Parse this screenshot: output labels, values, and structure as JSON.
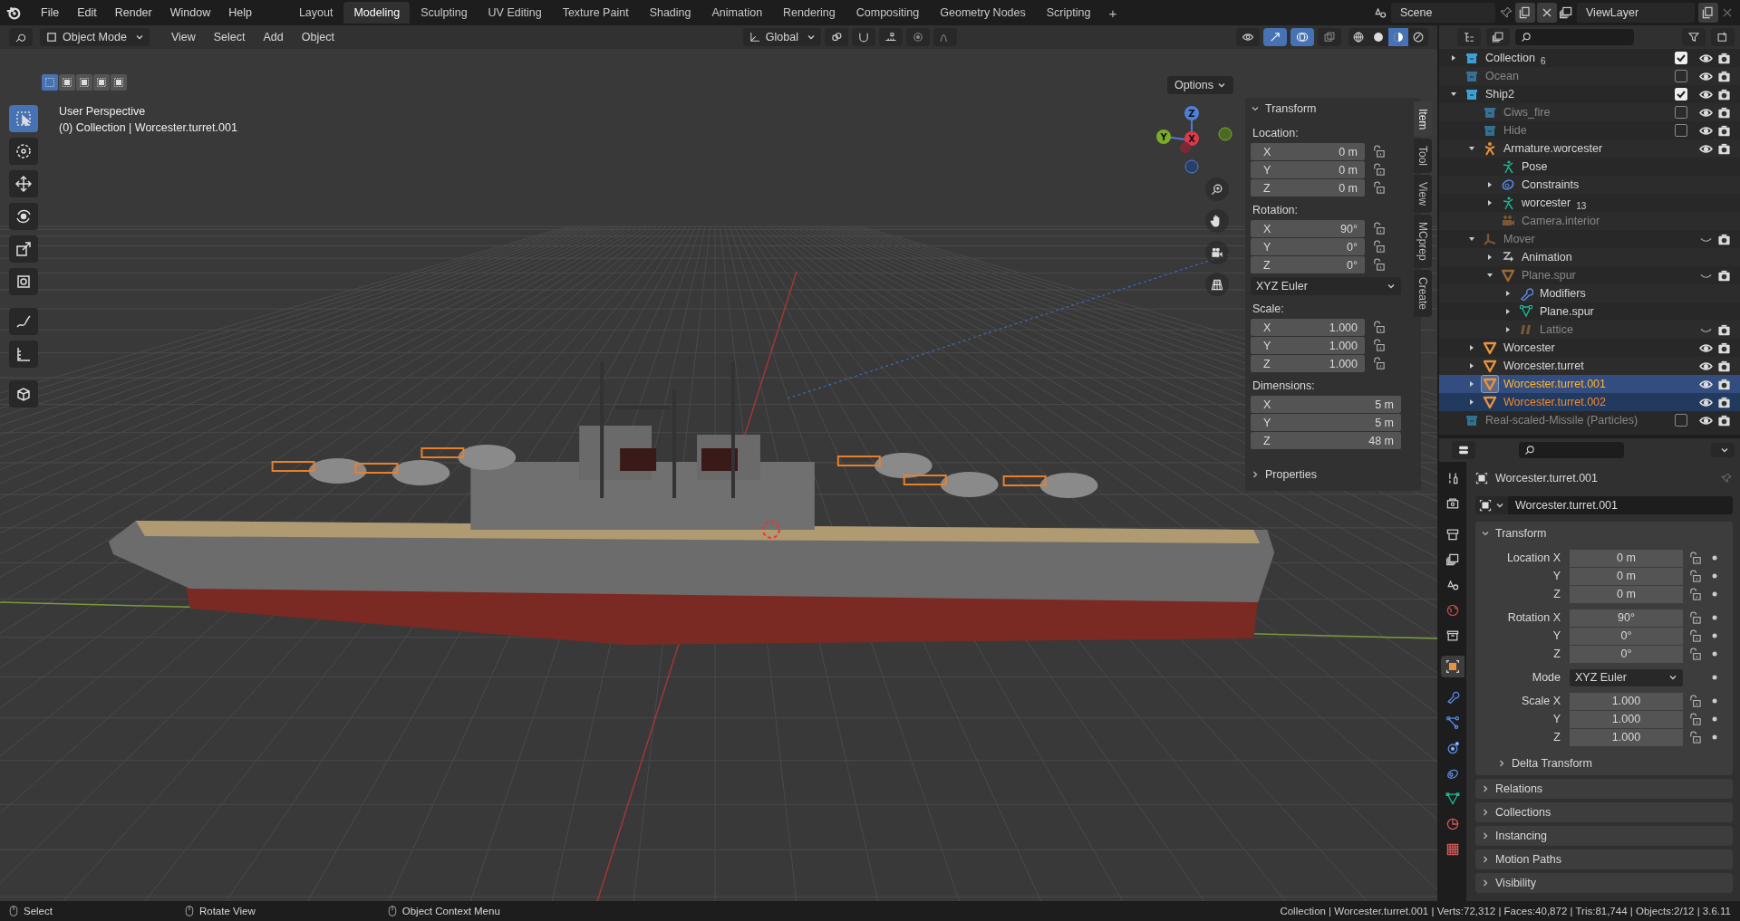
{
  "menu": [
    "File",
    "Edit",
    "Render",
    "Window",
    "Help"
  ],
  "workspaces": [
    {
      "label": "Layout",
      "selected": false
    },
    {
      "label": "Modeling",
      "selected": true
    },
    {
      "label": "Sculpting",
      "selected": false
    },
    {
      "label": "UV Editing",
      "selected": false
    },
    {
      "label": "Texture Paint",
      "selected": false
    },
    {
      "label": "Shading",
      "selected": false
    },
    {
      "label": "Animation",
      "selected": false
    },
    {
      "label": "Rendering",
      "selected": false
    },
    {
      "label": "Compositing",
      "selected": false
    },
    {
      "label": "Geometry Nodes",
      "selected": false
    },
    {
      "label": "Scripting",
      "selected": false
    }
  ],
  "add_workspace": "+",
  "scene": "Scene",
  "view_layer": "ViewLayer",
  "viewport": {
    "mode": "Object Mode",
    "menus": [
      "View",
      "Select",
      "Add",
      "Object"
    ],
    "orientation": "Global",
    "options": "Options",
    "select_modes": [
      {
        "selected": true
      },
      {
        "selected": false
      },
      {
        "selected": false
      },
      {
        "selected": false
      },
      {
        "selected": false
      }
    ],
    "shading": [
      {
        "kind": "wireframe",
        "selected": false
      },
      {
        "kind": "solid",
        "selected": false
      },
      {
        "kind": "material",
        "selected": true
      },
      {
        "kind": "rendered",
        "selected": false
      }
    ],
    "tools": [
      {
        "kind": "select",
        "selected": true
      },
      {
        "kind": "cursor",
        "selected": false
      },
      {
        "kind": "move",
        "selected": false
      },
      {
        "kind": "rotate",
        "selected": false
      },
      {
        "kind": "scale",
        "selected": false
      },
      {
        "kind": "transform",
        "selected": false
      },
      {
        "kind": "annotate",
        "selected": false
      },
      {
        "kind": "measure",
        "selected": false
      },
      {
        "kind": "cube",
        "selected": false
      }
    ],
    "overlay_lines": [
      "User Perspective",
      "(0) Collection | Worcester.turret.001"
    ],
    "gizmo": {
      "z": "Z",
      "y": "Y",
      "x": "X"
    }
  },
  "sidebar": {
    "tabs": [
      {
        "label": "Item",
        "selected": true
      },
      {
        "label": "Tool",
        "selected": false
      },
      {
        "label": "View",
        "selected": false
      },
      {
        "label": "MCprep",
        "selected": false
      },
      {
        "label": "Create",
        "selected": false
      }
    ],
    "title": "Transform",
    "groups": [
      {
        "label": "Location:",
        "kind": "locked",
        "rows": [
          {
            "axis": "X",
            "value": "0 m"
          },
          {
            "axis": "Y",
            "value": "0 m"
          },
          {
            "axis": "Z",
            "value": "0 m"
          }
        ]
      },
      {
        "label": "Rotation:",
        "kind": "locked",
        "rows": [
          {
            "axis": "X",
            "value": "90°"
          },
          {
            "axis": "Y",
            "value": "0°"
          },
          {
            "axis": "Z",
            "value": "0°"
          }
        ],
        "mode": "XYZ Euler"
      },
      {
        "label": "Scale:",
        "kind": "locked",
        "rows": [
          {
            "axis": "X",
            "value": "1.000"
          },
          {
            "axis": "Y",
            "value": "1.000"
          },
          {
            "axis": "Z",
            "value": "1.000"
          }
        ]
      },
      {
        "label": "Dimensions:",
        "kind": "wide",
        "rows": [
          {
            "axis": "X",
            "value": "5 m"
          },
          {
            "axis": "Y",
            "value": "5 m"
          },
          {
            "axis": "Z",
            "value": "48 m"
          }
        ]
      }
    ],
    "collapsed_panel": "Properties"
  },
  "outliner": {
    "items": [
      {
        "name": "Collection",
        "kind": "collection",
        "expanded": false,
        "dimmed": false,
        "selected": false,
        "active": false,
        "checked": true,
        "visible": true,
        "count": "6"
      },
      {
        "name": "Ocean",
        "kind": "collection",
        "dimmed": true,
        "selected": false,
        "active": false,
        "checked": false,
        "visible": true
      },
      {
        "name": "Ship2",
        "kind": "collection",
        "expanded": true,
        "dimmed": false,
        "selected": false,
        "active": false,
        "checked": true,
        "visible": true,
        "children": [
          {
            "name": "Ciws_fire",
            "kind": "collection",
            "dimmed": true,
            "selected": false,
            "active": false,
            "checked": false,
            "visible": true
          },
          {
            "name": "Hide",
            "kind": "collection",
            "dimmed": true,
            "selected": false,
            "active": false,
            "checked": false,
            "visible": true
          },
          {
            "name": "Armature.worcester",
            "kind": "armature",
            "expanded": true,
            "dimmed": false,
            "selected": false,
            "active": false,
            "visible": true,
            "children": [
              {
                "name": "Pose",
                "kind": "pose",
                "dimmed": false,
                "selected": false,
                "active": false
              },
              {
                "name": "Constraints",
                "kind": "constraints",
                "expanded": false,
                "dimmed": false,
                "selected": false,
                "active": false
              },
              {
                "name": "worcester",
                "kind": "pose",
                "expanded": false,
                "dimmed": false,
                "selected": false,
                "active": false,
                "count": "13"
              },
              {
                "name": "Camera.interior",
                "kind": "camera",
                "dimmed": true,
                "selected": false,
                "active": false
              }
            ]
          },
          {
            "name": "Mover",
            "kind": "empty",
            "expanded": true,
            "dimmed": true,
            "selected": false,
            "active": false,
            "visible": false,
            "children": [
              {
                "name": "Animation",
                "kind": "animation",
                "expanded": false,
                "dimmed": false,
                "selected": false,
                "active": false
              },
              {
                "name": "Plane.spur",
                "kind": "mesh",
                "expanded": true,
                "dimmed": true,
                "selected": false,
                "active": false,
                "visible": false,
                "children": [
                  {
                    "name": "Modifiers",
                    "kind": "modifiers",
                    "expanded": false,
                    "dimmed": false,
                    "selected": false,
                    "active": false
                  },
                  {
                    "name": "Plane.spur",
                    "kind": "meshdata",
                    "expanded": false,
                    "dimmed": false,
                    "selected": false,
                    "active": false
                  },
                  {
                    "name": "Lattice",
                    "kind": "lattice",
                    "expanded": false,
                    "dimmed": true,
                    "selected": false,
                    "active": false,
                    "visible": false
                  }
                ]
              }
            ]
          },
          {
            "name": "Worcester",
            "kind": "mesh",
            "expanded": false,
            "dimmed": false,
            "selected": false,
            "active": false,
            "visible": true
          },
          {
            "name": "Worcester.turret",
            "kind": "mesh",
            "expanded": false,
            "dimmed": false,
            "selected": false,
            "active": false,
            "visible": true
          },
          {
            "name": "Worcester.turret.001",
            "kind": "mesh",
            "expanded": false,
            "dimmed": false,
            "selected": true,
            "active": true,
            "visible": true
          },
          {
            "name": "Worcester.turret.002",
            "kind": "mesh",
            "expanded": false,
            "dimmed": false,
            "selected": true,
            "active": false,
            "visible": true
          }
        ]
      },
      {
        "name": "Real-scaled-Missile (Particles)",
        "kind": "collection",
        "dimmed": true,
        "selected": false,
        "active": false,
        "checked": false,
        "visible": true
      }
    ]
  },
  "properties": {
    "tabs": [
      {
        "kind": "tool",
        "selected": false
      },
      {
        "kind": "render",
        "selected": false
      },
      {
        "kind": "output",
        "selected": false
      },
      {
        "kind": "viewlayer",
        "selected": false
      },
      {
        "kind": "scene",
        "selected": false
      },
      {
        "kind": "world",
        "selected": false
      },
      {
        "kind": "collection",
        "selected": false
      },
      {
        "kind": "object",
        "selected": true
      },
      {
        "kind": "modifier",
        "selected": false
      },
      {
        "kind": "particles",
        "selected": false
      },
      {
        "kind": "physics",
        "selected": false
      },
      {
        "kind": "constraint",
        "selected": false
      },
      {
        "kind": "data",
        "selected": false
      },
      {
        "kind": "material",
        "selected": false
      },
      {
        "kind": "texture",
        "selected": false
      }
    ],
    "title": "Worcester.turret.001",
    "datablock": "Worcester.turret.001",
    "panel_title": "Transform",
    "groups": [
      [
        {
          "label": "Location X",
          "value": "0 m",
          "kind": "number"
        },
        {
          "label": "Y",
          "value": "0 m",
          "kind": "number"
        },
        {
          "label": "Z",
          "value": "0 m",
          "kind": "number"
        }
      ],
      [
        {
          "label": "Rotation X",
          "value": "90°",
          "kind": "number"
        },
        {
          "label": "Y",
          "value": "0°",
          "kind": "number"
        },
        {
          "label": "Z",
          "value": "0°",
          "kind": "number"
        }
      ],
      [
        {
          "label": "Mode",
          "value": "XYZ Euler",
          "kind": "dropdown"
        }
      ],
      [
        {
          "label": "Scale X",
          "value": "1.000",
          "kind": "number"
        },
        {
          "label": "Y",
          "value": "1.000",
          "kind": "number"
        },
        {
          "label": "Z",
          "value": "1.000",
          "kind": "number"
        }
      ]
    ],
    "subpanel": "Delta Transform",
    "panels": [
      "Relations",
      "Collections",
      "Instancing",
      "Motion Paths",
      "Visibility"
    ]
  },
  "status": {
    "hints": [
      "Select",
      "Rotate View",
      "Object Context Menu"
    ],
    "stats": "Collection | Worcester.turret.001 | Verts:72,312 | Faces:40,872 | Tris:81,744 | Objects:2/12 | 3.6.11"
  }
}
